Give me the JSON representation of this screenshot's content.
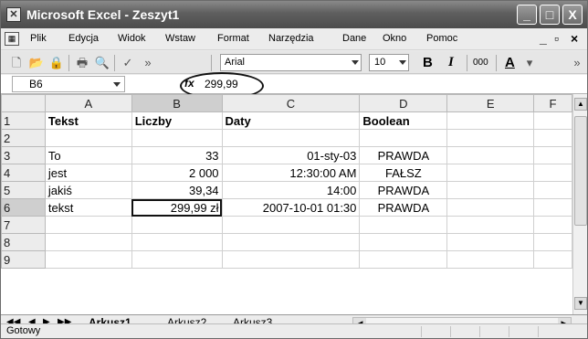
{
  "window": {
    "title": "Microsoft Excel - Zeszyt1"
  },
  "window_buttons": {
    "minimize": "_",
    "maximize": "□",
    "close": "X"
  },
  "menu": {
    "items": [
      "Plik",
      "Edycja",
      "Widok",
      "Wstaw",
      "Format",
      "Narzędzia",
      "Dane",
      "Okno",
      "Pomoc"
    ],
    "doc_min": "_",
    "doc_restore": "▫",
    "doc_close": "×"
  },
  "toolbar": {
    "font": "Arial",
    "size": "10",
    "bold": "B",
    "italic": "I",
    "thousands": "000",
    "font_color": "A"
  },
  "formula_bar": {
    "name_box": "B6",
    "fx": "fx",
    "value": "299,99"
  },
  "sheet": {
    "columns": [
      "A",
      "B",
      "C",
      "D",
      "E",
      "F"
    ],
    "rows": [
      {
        "num": "1",
        "cells": [
          "Tekst",
          "Liczby",
          "Daty",
          "Boolean",
          "",
          ""
        ]
      },
      {
        "num": "2",
        "cells": [
          "",
          "",
          "",
          "",
          "",
          ""
        ]
      },
      {
        "num": "3",
        "cells": [
          "To",
          "33",
          "01-sty-03",
          "PRAWDA",
          "",
          ""
        ]
      },
      {
        "num": "4",
        "cells": [
          "jest",
          "2 000",
          "12:30:00 AM",
          "FAŁSZ",
          "",
          ""
        ]
      },
      {
        "num": "5",
        "cells": [
          "jakiś",
          "39,34",
          "14:00",
          "PRAWDA",
          "",
          ""
        ]
      },
      {
        "num": "6",
        "cells": [
          "tekst",
          "299,99 zł",
          "2007-10-01 01:30",
          "PRAWDA",
          "",
          ""
        ]
      },
      {
        "num": "7",
        "cells": [
          "",
          "",
          "",
          "",
          "",
          ""
        ]
      },
      {
        "num": "8",
        "cells": [
          "",
          "",
          "",
          "",
          "",
          ""
        ]
      },
      {
        "num": "9",
        "cells": [
          "",
          "",
          "",
          "",
          "",
          ""
        ]
      }
    ],
    "active_cell": "B6"
  },
  "tabs": {
    "items": [
      "Arkusz1",
      "Arkusz2",
      "Arkusz3"
    ],
    "active": "Arkusz1"
  },
  "status": {
    "text": "Gotowy"
  }
}
